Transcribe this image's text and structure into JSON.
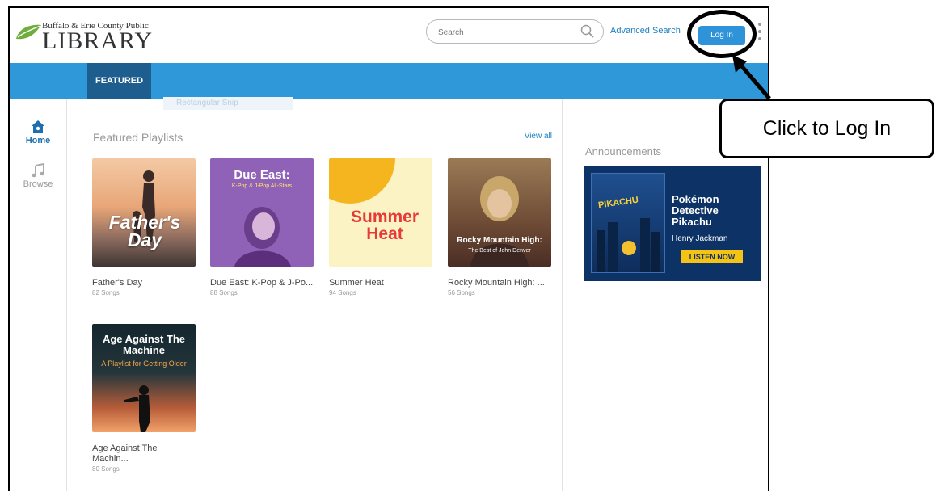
{
  "header": {
    "logo_small": "Buffalo & Erie County Public",
    "logo_big": "LIBRARY",
    "search_placeholder": "Search",
    "advanced_search": "Advanced Search",
    "login_label": "Log In"
  },
  "nav": {
    "active_tab": "FEATURED",
    "ghost_label": "Rectangular Snip"
  },
  "sidebar": {
    "items": [
      {
        "label": "Home",
        "icon": "home-icon"
      },
      {
        "label": "Browse",
        "icon": "music-note-icon"
      }
    ]
  },
  "main": {
    "section_title": "Featured Playlists",
    "view_all": "View all",
    "playlists": [
      {
        "name": "Father's Day",
        "count": "82 Songs",
        "art_text": "Father's Day"
      },
      {
        "name": "Due East: K-Pop & J-Po...",
        "count": "88 Songs",
        "art_title": "Due East:",
        "art_sub": "K-Pop & J-Pop All-Stars"
      },
      {
        "name": "Summer Heat",
        "count": "94 Songs",
        "art_text": "Summer Heat"
      },
      {
        "name": "Rocky Mountain High: ...",
        "count": "56 Songs",
        "art_title": "Rocky Mountain High:",
        "art_sub": "The Best of John Denver"
      },
      {
        "name": "Age Against The Machin...",
        "count": "80 Songs",
        "art_title": "Age Against The Machine",
        "art_sub": "A Playlist for Getting Older"
      }
    ]
  },
  "right": {
    "title": "Announcements",
    "promo": {
      "movie": "PIKACHU",
      "title": "Pokémon Detective Pikachu",
      "artist": "Henry Jackman",
      "cta": "LISTEN NOW"
    }
  },
  "callout": {
    "text": "Click to Log In"
  },
  "colors": {
    "nav_blue": "#2f98d9",
    "tab_dark": "#1d5e8f",
    "login_blue": "#2f93d9",
    "link_blue": "#1e7fbf"
  }
}
